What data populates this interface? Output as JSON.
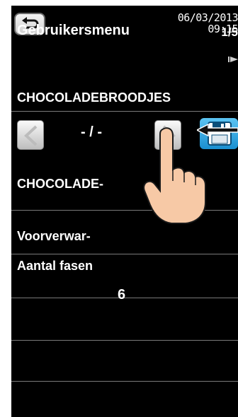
{
  "header": {
    "date": "06/03/2013",
    "time": "09:15",
    "title": "Gebruikersmenu",
    "page": "1/5"
  },
  "recipe": {
    "name": "CHOCOLADEBROODJES"
  },
  "navigator": {
    "counter": "- / -"
  },
  "rows": [
    {
      "label": "CHOCOLADE-"
    },
    {
      "label": "Voorverwar-"
    },
    {
      "label": "Aantal fasen",
      "value": "6"
    }
  ],
  "colors": {
    "background": "#000000",
    "text": "#ffffff",
    "save_button": "#1a8fd0",
    "separator": "#7a7a7a"
  },
  "icons": {
    "back": "back-arrow-icon",
    "prev": "chevron-left-icon",
    "next": "chevron-right-icon",
    "save": "floppy-disk-icon",
    "page_next": "next-page-arrow-icon"
  }
}
